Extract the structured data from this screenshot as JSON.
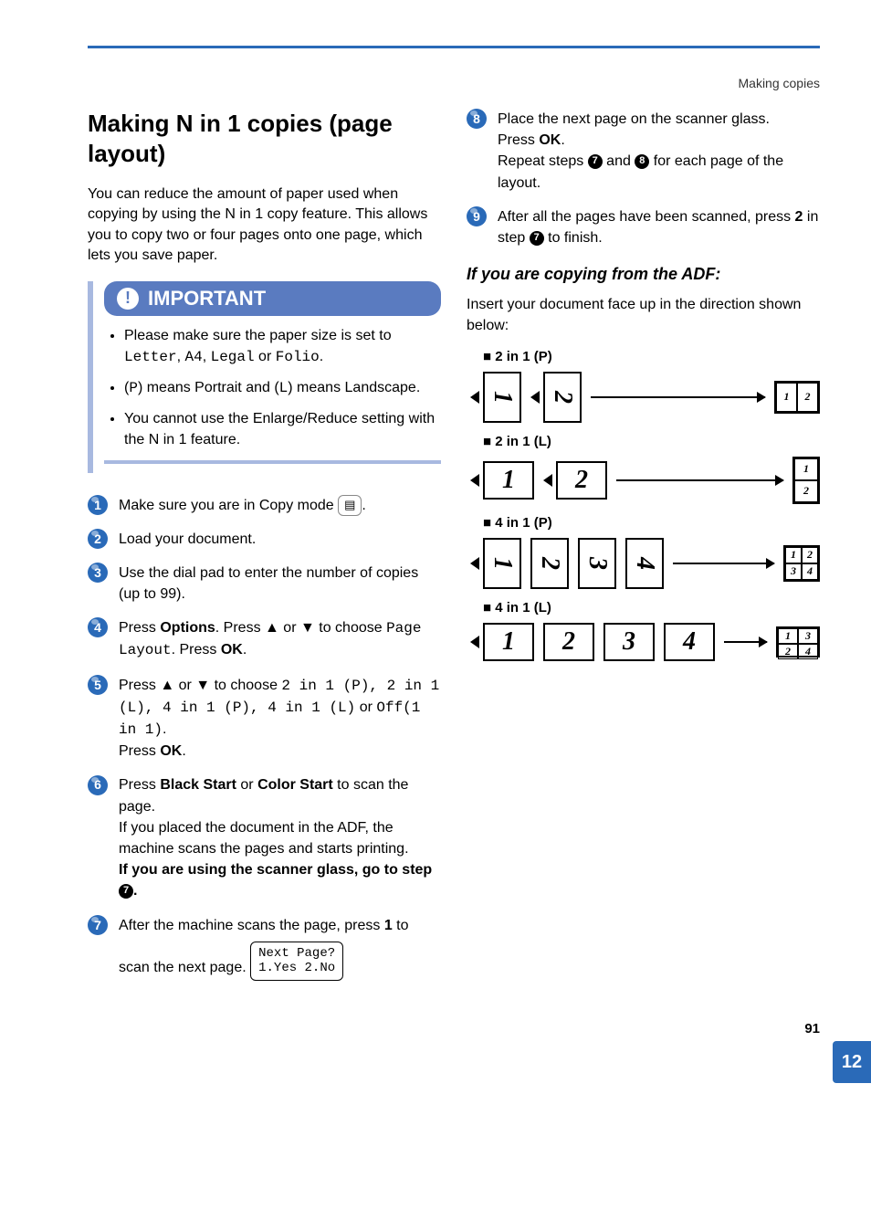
{
  "breadcrumb": "Making copies",
  "section_title": "Making N in 1 copies (page layout)",
  "intro": "You can reduce the amount of paper used when copying by using the N in 1 copy feature. This allows you to copy two or four pages onto one page, which lets you save paper.",
  "important": {
    "label": "IMPORTANT",
    "items": {
      "a_pre": "Please make sure the paper size is set to ",
      "a_sizes": [
        "Letter",
        "A4",
        "Legal",
        "Folio"
      ],
      "a_or": " or ",
      "b_pre": "(",
      "b_p": "P",
      "b_mid1": ") means Portrait and (",
      "b_l": "L",
      "b_mid2": ") means Landscape.",
      "c": "You cannot use the Enlarge/Reduce setting with the N in 1 feature."
    }
  },
  "steps_left": {
    "s1": "Make sure you are in Copy mode ",
    "s2": "Load your document.",
    "s3": "Use the dial pad to enter the number of copies (up to 99).",
    "s4_a": "Press ",
    "s4_options": "Options",
    "s4_b": ". Press ▲ or ▼ to choose ",
    "s4_layout": "Page Layout",
    "s4_c": ". Press ",
    "s4_ok": "OK",
    "s5_a": "Press ▲ or ▼ to choose ",
    "s5_opts": "2 in 1 (P), 2 in 1 (L), 4 in 1 (P), 4 in 1 (L)",
    "s5_or": " or ",
    "s5_off": "Off(1 in 1)",
    "s5_press": "Press ",
    "s5_ok": "OK",
    "s6_a": "Press ",
    "s6_black": "Black Start",
    "s6_or": " or ",
    "s6_color": "Color Start",
    "s6_b": " to scan the page.",
    "s6_c": "If you placed the document in the ADF, the machine scans the pages and starts printing.",
    "s6_d_pre": "If you are using the scanner glass, go to step ",
    "s6_ref": "7",
    "s7_a": "After the machine scans the page, press ",
    "s7_one": "1",
    "s7_b": " to scan the next page.",
    "s7_lcd1": "Next Page?",
    "s7_lcd2": "1.Yes 2.No"
  },
  "steps_right": {
    "s8_a": "Place the next page on the scanner glass.",
    "s8_b": "Press ",
    "s8_ok": "OK",
    "s8_c_pre": "Repeat steps ",
    "s8_ref1": "7",
    "s8_and": " and ",
    "s8_ref2": "8",
    "s8_c_post": " for each page of the layout.",
    "s9_a": "After all the pages have been scanned, press ",
    "s9_two": "2",
    "s9_b": " in step ",
    "s9_ref": "7",
    "s9_c": " to finish."
  },
  "adf": {
    "heading": "If you are copying from the ADF:",
    "intro": "Insert your document face up in the direction shown below:",
    "layouts": {
      "l1": "2 in 1 (P)",
      "l2": "2 in 1 (L)",
      "l3": "4 in 1 (P)",
      "l4": "4 in 1 (L)"
    }
  },
  "tab": "12",
  "page_num": "91",
  "dot": "."
}
